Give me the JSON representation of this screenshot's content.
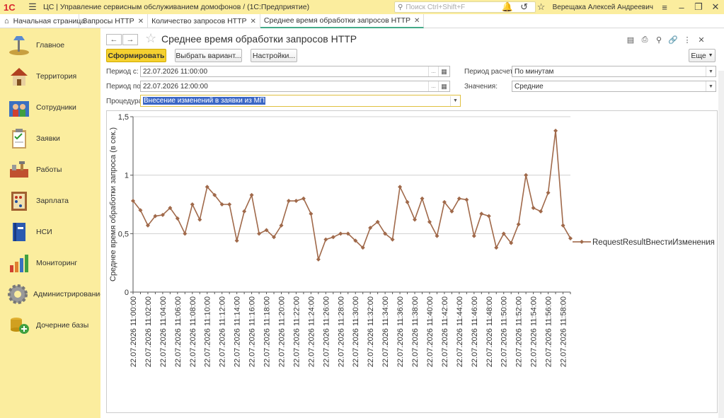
{
  "titlebar": {
    "logo": "1С",
    "app_title": "ЦС | Управление сервисным обслуживанием домофонов /  (1С:Предприятие)",
    "search_placeholder": "Поиск Ctrl+Shift+F",
    "user": "Верещака Алексей Андреевич"
  },
  "tabs": {
    "home": "Начальная страница",
    "items": [
      {
        "label": "Запросы HTTP"
      },
      {
        "label": "Количество запросов HTTP"
      },
      {
        "label": "Среднее время обработки запросов HTTP"
      }
    ]
  },
  "sidebar": {
    "items": [
      {
        "label": "Главное",
        "icon": "desk-lamp-icon"
      },
      {
        "label": "Территория",
        "icon": "house-icon"
      },
      {
        "label": "Сотрудники",
        "icon": "people-icon"
      },
      {
        "label": "Заявки",
        "icon": "clipboard-icon"
      },
      {
        "label": "Работы",
        "icon": "tools-icon"
      },
      {
        "label": "Зарплата",
        "icon": "abacus-icon"
      },
      {
        "label": "НСИ",
        "icon": "book-icon"
      },
      {
        "label": "Мониторинг",
        "icon": "bar-chart-icon"
      },
      {
        "label": "Администрирование",
        "icon": "gear-icon"
      },
      {
        "label": "Дочерние базы",
        "icon": "database-icon"
      }
    ]
  },
  "form": {
    "title": "Среднее время обработки запросов HTTP",
    "generate_button": "Сформировать",
    "variant_button": "Выбрать вариант...",
    "settings_button": "Настройки...",
    "more_button": "Еще",
    "period_from_label": "Период с:",
    "period_from_value": "22.07.2026 11:00:00",
    "period_to_label": "Период по:",
    "period_to_value": "22.07.2026 12:00:00",
    "calc_period_label": "Период расчета:",
    "calc_period_value": "По минутам",
    "values_label": "Значения:",
    "values_value": "Средние",
    "procedure_label": "Процедура:",
    "procedure_value": "Внесение изменений в заявки из МП"
  },
  "chart_data": {
    "type": "line",
    "ylabel": "Среднее время обработки запроса (в сек.)",
    "ylim": [
      0,
      1.5
    ],
    "yticks": [
      "0",
      "0,5",
      "1",
      "1,5"
    ],
    "grid": true,
    "legend_position": "right",
    "series": [
      {
        "name": "RequestResultВнестиИзменения",
        "color": "#a0694a",
        "values": [
          0.78,
          0.7,
          0.57,
          0.65,
          0.66,
          0.72,
          0.63,
          0.5,
          0.75,
          0.62,
          0.9,
          0.83,
          0.75,
          0.75,
          0.44,
          0.69,
          0.83,
          0.5,
          0.53,
          0.47,
          0.57,
          0.78,
          0.78,
          0.8,
          0.67,
          0.28,
          0.45,
          0.47,
          0.5,
          0.5,
          0.44,
          0.38,
          0.55,
          0.6,
          0.5,
          0.45,
          0.9,
          0.77,
          0.62,
          0.8,
          0.6,
          0.48,
          0.77,
          0.69,
          0.8,
          0.79,
          0.48,
          0.67,
          0.65,
          0.38,
          0.5,
          0.42,
          0.58,
          1.0,
          0.72,
          0.69,
          0.85,
          1.38,
          0.57,
          0.46
        ]
      }
    ],
    "x_labels": [
      "22.07.2026 11:00:00",
      "22.07.2026 11:02:00",
      "22.07.2026 11:04:00",
      "22.07.2026 11:06:00",
      "22.07.2026 11:08:00",
      "22.07.2026 11:10:00",
      "22.07.2026 11:12:00",
      "22.07.2026 11:14:00",
      "22.07.2026 11:16:00",
      "22.07.2026 11:18:00",
      "22.07.2026 11:20:00",
      "22.07.2026 11:22:00",
      "22.07.2026 11:24:00",
      "22.07.2026 11:26:00",
      "22.07.2026 11:28:00",
      "22.07.2026 11:30:00",
      "22.07.2026 11:32:00",
      "22.07.2026 11:34:00",
      "22.07.2026 11:36:00",
      "22.07.2026 11:38:00",
      "22.07.2026 11:40:00",
      "22.07.2026 11:42:00",
      "22.07.2026 11:44:00",
      "22.07.2026 11:46:00",
      "22.07.2026 11:48:00",
      "22.07.2026 11:50:00",
      "22.07.2026 11:52:00",
      "22.07.2026 11:54:00",
      "22.07.2026 11:56:00",
      "22.07.2026 11:58:00"
    ]
  }
}
